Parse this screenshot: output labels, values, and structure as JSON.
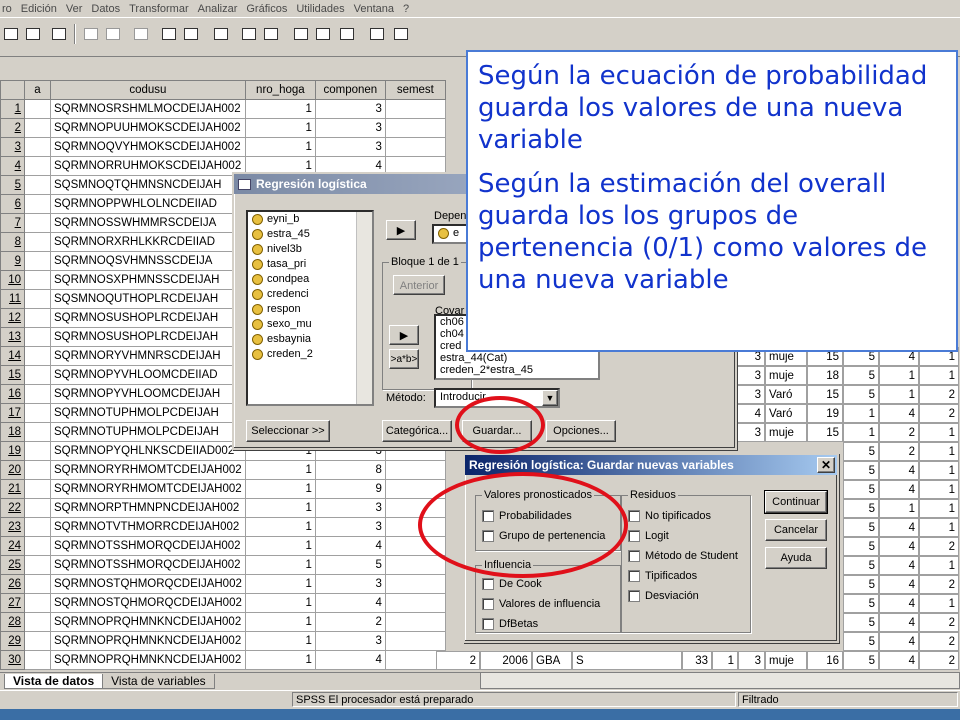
{
  "menubar": {
    "items": [
      "ro",
      "Edición",
      "Ver",
      "Datos",
      "Transformar",
      "Analizar",
      "Gráficos",
      "Utilidades",
      "Ventana",
      "?"
    ]
  },
  "grid": {
    "headers": [
      "",
      "a",
      "codusu",
      "nro_hoga",
      "componen",
      "semest"
    ],
    "rows": [
      [
        "1",
        "",
        "SQRMNOSRSHMLMOCDEIJAH002",
        "1",
        "3"
      ],
      [
        "2",
        "",
        "SQRMNOPUUHMOKSCDEIJAH002",
        "1",
        "3"
      ],
      [
        "3",
        "",
        "SQRMNOQVYHMOKSCDEIJAH002",
        "1",
        "3"
      ],
      [
        "4",
        "",
        "SQRMNORRUHMOKSCDEIJAH002",
        "1",
        "4"
      ],
      [
        "5",
        "",
        "SQSMNOQTQHMNSNCDEIJAH",
        "",
        ""
      ],
      [
        "6",
        "",
        "SQRMNOPPWHLOLNCDEIIAD",
        "",
        ""
      ],
      [
        "7",
        "",
        "SQRMNOSSWHMMRSCDEIJA",
        "",
        ""
      ],
      [
        "8",
        "",
        "SQRMNORXRHLKKRCDEIIAD",
        "",
        ""
      ],
      [
        "9",
        "",
        "SQRMNOQSVHMNSSCDEIJA",
        "",
        ""
      ],
      [
        "10",
        "",
        "SQRMNOSXPHMNSSCDEIJAH",
        "",
        ""
      ],
      [
        "11",
        "",
        "SQSMNOQUTHOPLRCDEIJAH",
        "",
        ""
      ],
      [
        "12",
        "",
        "SQRMNOSUSHOPLRCDEIJAH",
        "",
        ""
      ],
      [
        "13",
        "",
        "SQRMNOSUSHOPLRCDEIJAH",
        "",
        ""
      ],
      [
        "14",
        "",
        "SQRMNORYVHMNRSCDEIJAH",
        "",
        ""
      ],
      [
        "15",
        "",
        "SQRMNOPYVHLOOMCDEIIAD",
        "",
        ""
      ],
      [
        "16",
        "",
        "SQRMNOPYVHLOOMCDEIJAH",
        "",
        ""
      ],
      [
        "17",
        "",
        "SQRMNOTUPHMOLPCDEIJAH",
        "",
        ""
      ],
      [
        "18",
        "",
        "SQRMNOTUPHMOLPCDEIJAH",
        "",
        ""
      ],
      [
        "19",
        "",
        "SQRMNOPYQHLNKSCDEIIAD002",
        "1",
        "3"
      ],
      [
        "20",
        "",
        "SQRMNORYRHMOMTCDEIJAH002",
        "1",
        "8"
      ],
      [
        "21",
        "",
        "SQRMNORYRHMOMTCDEIJAH002",
        "1",
        "9"
      ],
      [
        "22",
        "",
        "SQRMNORPTHMNPNCDEIJAH002",
        "1",
        "3"
      ],
      [
        "23",
        "",
        "SQRMNOTVTHMORRCDEIJAH002",
        "1",
        "3"
      ],
      [
        "24",
        "",
        "SQRMNOTSSHMORQCDEIJAH002",
        "1",
        "4"
      ],
      [
        "25",
        "",
        "SQRMNOTSSHMORQCDEIJAH002",
        "1",
        "5"
      ],
      [
        "26",
        "",
        "SQRMNOSTQHMORQCDEIJAH002",
        "1",
        "3"
      ],
      [
        "27",
        "",
        "SQRMNOSTQHMORQCDEIJAH002",
        "1",
        "4"
      ],
      [
        "28",
        "",
        "SQRMNOPRQHMNKNCDEIJAH002",
        "1",
        "2"
      ],
      [
        "29",
        "",
        "SQRMNOPRQHMNKNCDEIJAH002",
        "1",
        "3"
      ],
      [
        "30",
        "",
        "SQRMNOPRQHMNKNCDEIJAH002",
        "1",
        "4"
      ]
    ],
    "right_rows": [
      [
        "",
        "",
        "",
        ""
      ],
      [
        "",
        "",
        "",
        ""
      ],
      [
        "",
        "",
        "",
        ""
      ],
      [
        "",
        "",
        "",
        ""
      ],
      [
        "",
        "",
        "",
        ""
      ],
      [
        "",
        "",
        "",
        ""
      ],
      [
        "",
        "",
        "",
        ""
      ],
      [
        "",
        "",
        "",
        ""
      ],
      [
        "",
        "",
        "",
        ""
      ],
      [
        "",
        "",
        "",
        ""
      ],
      [
        "",
        "",
        "",
        ""
      ],
      [
        "",
        "",
        "",
        ""
      ],
      [
        "",
        "",
        "",
        ""
      ],
      [
        "3",
        "muje",
        "15",
        "5"
      ],
      [
        "3",
        "muje",
        "18",
        "5"
      ],
      [
        "3",
        "Varó",
        "15",
        "5"
      ],
      [
        "4",
        "Varó",
        "19",
        "1"
      ],
      [
        "3",
        "muje",
        "15",
        "1"
      ]
    ],
    "right_tail": [
      [
        "4",
        "1"
      ],
      [
        "1",
        "1"
      ],
      [
        "1",
        "2"
      ],
      [
        "4",
        "2"
      ],
      [
        "2",
        "1"
      ]
    ],
    "far_right_tail": [
      [
        "5",
        "2",
        "1"
      ],
      [
        "5",
        "4",
        "1"
      ],
      [
        "5",
        "4",
        "1"
      ],
      [
        "5",
        "1",
        "1"
      ],
      [
        "5",
        "4",
        "1"
      ],
      [
        "5",
        "4",
        "2"
      ],
      [
        "5",
        "4",
        "1"
      ],
      [
        "5",
        "4",
        "2"
      ],
      [
        "5",
        "4",
        "1"
      ],
      [
        "5",
        "4",
        "2"
      ],
      [
        "5",
        "4",
        "2"
      ]
    ],
    "last_row_extra": [
      "2",
      "2006",
      "GBA",
      "S",
      "33",
      "1",
      "3",
      "muje",
      "16",
      "5",
      "4",
      "2"
    ]
  },
  "tabs": {
    "data_view": "Vista de datos",
    "variable_view": "Vista de variables"
  },
  "status": {
    "processor": "SPSS El procesador  está preparado",
    "filter": "Filtrado"
  },
  "logit_dialog": {
    "title": "Regresión logística",
    "variables": [
      "eyni_b",
      "estra_45",
      "nivel3b",
      "tasa_pri",
      "condpea",
      "credenci",
      "respon",
      "sexo_mu",
      "esbaynia",
      "creden_2"
    ],
    "dependent_label": "Depen",
    "dependent_value": "e",
    "block_label": "Bloque 1 de 1",
    "prev_button": "Anterior",
    "covariates_label": "Covar",
    "covariates": [
      "ch06",
      "ch04",
      "cred",
      "estra_44(Cat)",
      "creden_2*estra_45"
    ],
    "interaction_button": ">a*b>",
    "method_label": "Método:",
    "method_value": "Introducir",
    "buttons": {
      "select": "Seleccionar >>",
      "categorical": "Categórica...",
      "save": "Guardar...",
      "options": "Opciones..."
    }
  },
  "save_dialog": {
    "title": "Regresión logística: Guardar nuevas variables",
    "predicted": {
      "label": "Valores pronosticados",
      "items": [
        "Probabilidades",
        "Grupo de pertenencia"
      ]
    },
    "influence": {
      "label": "Influencia",
      "items": [
        "De Cook",
        "Valores de influencia",
        "DfBetas"
      ]
    },
    "residuals": {
      "label": "Residuos",
      "items": [
        "No tipificados",
        "Logit",
        "Método de Student",
        "Tipificados",
        "Desviación"
      ]
    },
    "buttons": {
      "continue": "Continuar",
      "cancel": "Cancelar",
      "help": "Ayuda"
    }
  },
  "callout": {
    "paragraph1": "Según la ecuación de probabilidad guarda los valores de una nueva variable",
    "paragraph2": "Según la estimación del overall guarda los los grupos de pertenencia (0/1) como valores de una nueva variable"
  },
  "colors": {
    "callout_text": "#1133cc",
    "callout_border": "#4a7bd6",
    "highlight_ellipse": "#e0101a",
    "title_active": "#0a246a"
  }
}
